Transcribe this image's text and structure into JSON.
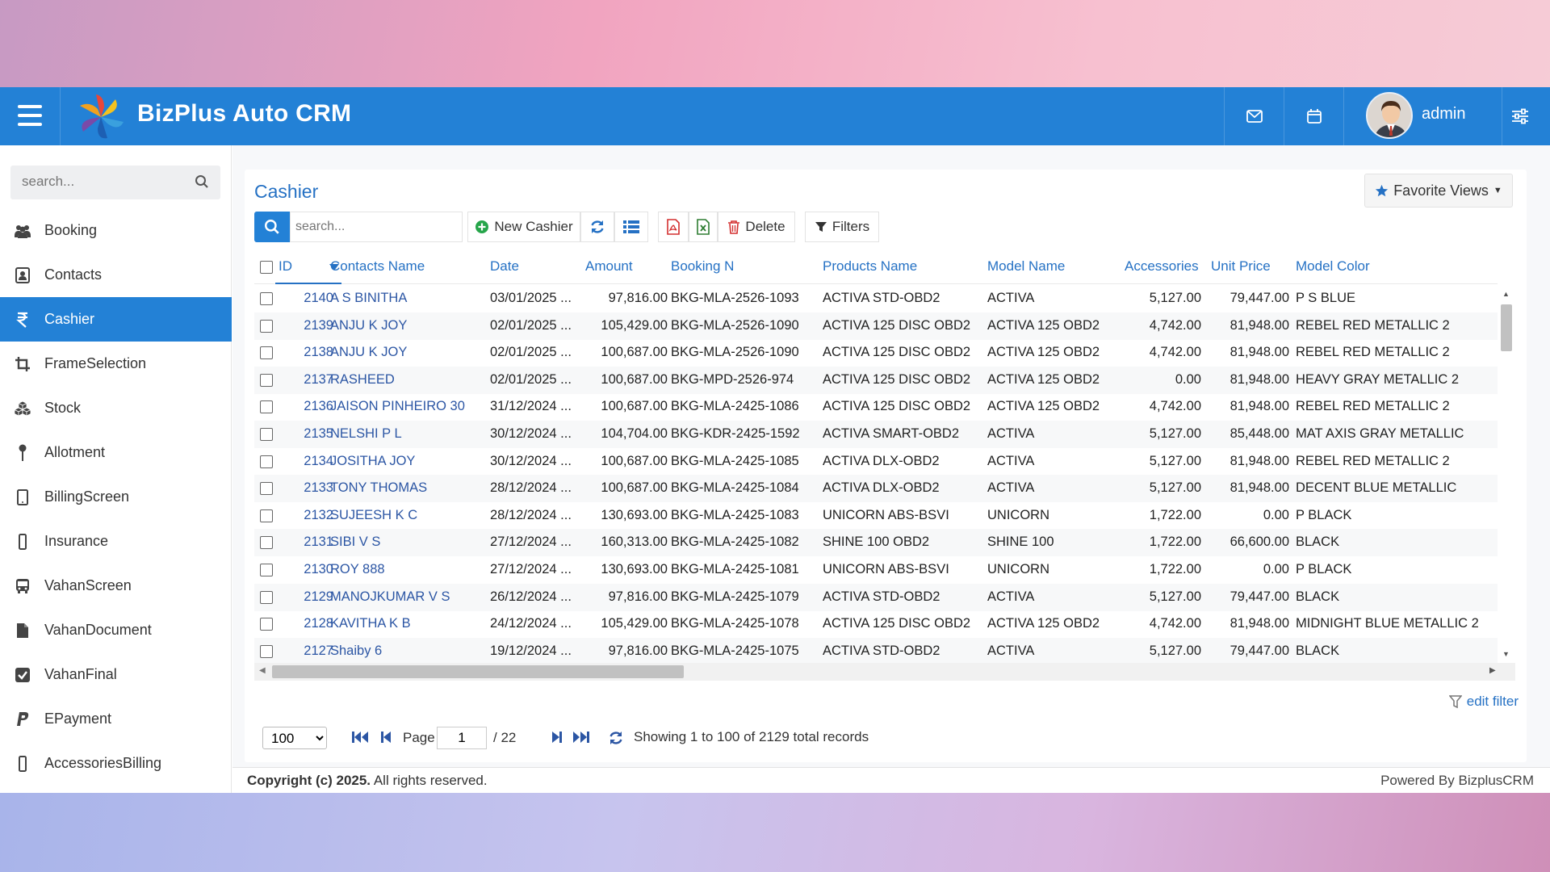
{
  "app": {
    "brand": "BizPlus Auto CRM",
    "user": "admin",
    "accent": "#2381d6"
  },
  "sidebar": {
    "search_placeholder": "search...",
    "items": [
      {
        "label": "Booking",
        "icon": "users-icon"
      },
      {
        "label": "Contacts",
        "icon": "contact-card-icon"
      },
      {
        "label": "Cashier",
        "icon": "rupee-icon",
        "active": true
      },
      {
        "label": "FrameSelection",
        "icon": "crop-icon"
      },
      {
        "label": "Stock",
        "icon": "cubes-icon"
      },
      {
        "label": "Allotment",
        "icon": "pin-icon"
      },
      {
        "label": "BillingScreen",
        "icon": "tablet-icon"
      },
      {
        "label": "Insurance",
        "icon": "mobile-icon"
      },
      {
        "label": "VahanScreen",
        "icon": "bus-icon"
      },
      {
        "label": "VahanDocument",
        "icon": "file-icon"
      },
      {
        "label": "VahanFinal",
        "icon": "check-square-icon"
      },
      {
        "label": "EPayment",
        "icon": "paypal-icon"
      },
      {
        "label": "AccessoriesBilling",
        "icon": "mobile-icon"
      }
    ]
  },
  "main": {
    "title": "Cashier",
    "favorite_views": "Favorite Views",
    "toolbar": {
      "search_placeholder": "search...",
      "new_label": "New Cashier",
      "delete_label": "Delete",
      "filters_label": "Filters"
    },
    "columns": [
      "ID",
      "Contacts Name",
      "Date",
      "Amount",
      "Booking N",
      "Products Name",
      "Model Name",
      "Accessories",
      "Unit Price",
      "Model Color"
    ],
    "rows": [
      [
        "2140",
        "A S BINITHA",
        "03/01/2025 ...",
        "97,816.00",
        "BKG-MLA-2526-1093",
        "ACTIVA STD-OBD2",
        "ACTIVA",
        "5,127.00",
        "79,447.00",
        "P S BLUE"
      ],
      [
        "2139",
        "ANJU K JOY",
        "02/01/2025 ...",
        "105,429.00",
        "BKG-MLA-2526-1090",
        "ACTIVA 125 DISC OBD2",
        "ACTIVA 125 OBD2",
        "4,742.00",
        "81,948.00",
        "REBEL RED METALLIC 2"
      ],
      [
        "2138",
        "ANJU K JOY",
        "02/01/2025 ...",
        "100,687.00",
        "BKG-MLA-2526-1090",
        "ACTIVA 125 DISC OBD2",
        "ACTIVA 125 OBD2",
        "4,742.00",
        "81,948.00",
        "REBEL RED METALLIC 2"
      ],
      [
        "2137",
        "RASHEED",
        "02/01/2025 ...",
        "100,687.00",
        "BKG-MPD-2526-974",
        "ACTIVA 125 DISC OBD2",
        "ACTIVA 125 OBD2",
        "0.00",
        "81,948.00",
        "HEAVY GRAY METALLIC 2"
      ],
      [
        "2136",
        "JAISON PINHEIRO 30",
        "31/12/2024 ...",
        "100,687.00",
        "BKG-MLA-2425-1086",
        "ACTIVA 125 DISC OBD2",
        "ACTIVA 125 OBD2",
        "4,742.00",
        "81,948.00",
        "REBEL RED METALLIC 2"
      ],
      [
        "2135",
        "NELSHI P L",
        "30/12/2024 ...",
        "104,704.00",
        "BKG-KDR-2425-1592",
        "ACTIVA SMART-OBD2",
        "ACTIVA",
        "5,127.00",
        "85,448.00",
        "MAT AXIS GRAY METALLIC"
      ],
      [
        "2134",
        "JOSITHA JOY",
        "30/12/2024 ...",
        "100,687.00",
        "BKG-MLA-2425-1085",
        "ACTIVA DLX-OBD2",
        "ACTIVA",
        "5,127.00",
        "81,948.00",
        "REBEL RED METALLIC 2"
      ],
      [
        "2133",
        "TONY THOMAS",
        "28/12/2024 ...",
        "100,687.00",
        "BKG-MLA-2425-1084",
        "ACTIVA DLX-OBD2",
        "ACTIVA",
        "5,127.00",
        "81,948.00",
        "DECENT BLUE METALLIC"
      ],
      [
        "2132",
        "SUJEESH K C",
        "28/12/2024 ...",
        "130,693.00",
        "BKG-MLA-2425-1083",
        "UNICORN ABS-BSVI",
        "UNICORN",
        "1,722.00",
        "0.00",
        "P BLACK"
      ],
      [
        "2131",
        "SIBI V S",
        "27/12/2024 ...",
        "160,313.00",
        "BKG-MLA-2425-1082",
        "SHINE 100 OBD2",
        "SHINE 100",
        "1,722.00",
        "66,600.00",
        "BLACK"
      ],
      [
        "2130",
        "ROY 888",
        "27/12/2024 ...",
        "130,693.00",
        "BKG-MLA-2425-1081",
        "UNICORN ABS-BSVI",
        "UNICORN",
        "1,722.00",
        "0.00",
        "P BLACK"
      ],
      [
        "2129",
        "MANOJKUMAR V S",
        "26/12/2024 ...",
        "97,816.00",
        "BKG-MLA-2425-1079",
        "ACTIVA STD-OBD2",
        "ACTIVA",
        "5,127.00",
        "79,447.00",
        "BLACK"
      ],
      [
        "2128",
        "KAVITHA K B",
        "24/12/2024 ...",
        "105,429.00",
        "BKG-MLA-2425-1078",
        "ACTIVA 125 DISC OBD2",
        "ACTIVA 125 OBD2",
        "4,742.00",
        "81,948.00",
        "MIDNIGHT BLUE METALLIC 2"
      ],
      [
        "2127",
        "Shaiby 6",
        "19/12/2024 ...",
        "97,816.00",
        "BKG-MLA-2425-1075",
        "ACTIVA STD-OBD2",
        "ACTIVA",
        "5,127.00",
        "79,447.00",
        "BLACK"
      ]
    ],
    "edit_filter": "edit filter",
    "pager": {
      "page_size": "100",
      "page_label": "Page",
      "page": "1",
      "total_pages": "/ 22",
      "summary": "Showing 1 to 100 of 2129 total records"
    }
  },
  "footer": {
    "copyright_bold": "Copyright (c) 2025.",
    "copyright_rest": " All rights reserved.",
    "powered": "Powered By BizplusCRM"
  }
}
